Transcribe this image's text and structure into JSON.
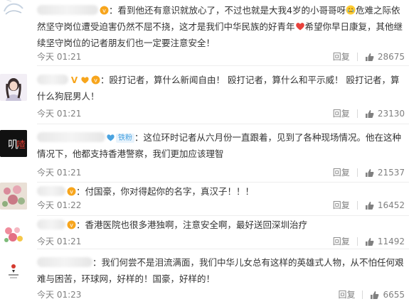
{
  "comments": [
    {
      "name_hidden": true,
      "text_a": "看到他还有意识就放心了，不过也就是大我4岁的小哥哥呀",
      "text_b": "危难之际依然坚守岗位遭受迫害仍然不屈不挠，这才是我们中华民族的好青年",
      "text_c": "希望你早日康复，其他继续坚守岗位的记者朋友们也一定要注意安全！",
      "time": "今天 01:21",
      "reply": "回复",
      "likes": "28675"
    },
    {
      "name_hidden": true,
      "text": "殴打记者，算什么新闻自由！ 殴打记者，算什么和平示威！ 殴打记者，算什么狗屁男人！",
      "time": "今天 01:21",
      "reply": "回复",
      "likes": "23130"
    },
    {
      "name_hidden": true,
      "fan_badge": "铁粉",
      "text": "这位环时记者从六月份一直跟着，见到了各种现场情况。他在这种情况下，他都支持香港警察，我们更加应该理智",
      "time": "今天 01:21",
      "reply": "回复",
      "likes": "21537"
    },
    {
      "name_hidden": true,
      "text": "付国豪，你对得起你的名字，真汉子！！！",
      "time": "今天 01:22",
      "reply": "回复",
      "likes": "16452"
    },
    {
      "name_hidden": true,
      "text": "香港医院也很多港独啊，注意安全啊，最好送回深圳治疗",
      "time": "今天 01:21",
      "reply": "回复",
      "likes": "11492"
    },
    {
      "name_hidden": true,
      "text": "我们何尝不是泪流满面，我们中华儿女总有这样的英雄式人物，从不怕任何艰难与困苦，环球网，好样的！国豪，好样的！",
      "time": "今天 01:23",
      "reply": "回复",
      "likes": "6655"
    }
  ],
  "colors": {
    "text": "#333333",
    "meta": "#808080",
    "divider": "#eeeeee",
    "vip": "#f7a51c",
    "heart": "#e8413b"
  }
}
